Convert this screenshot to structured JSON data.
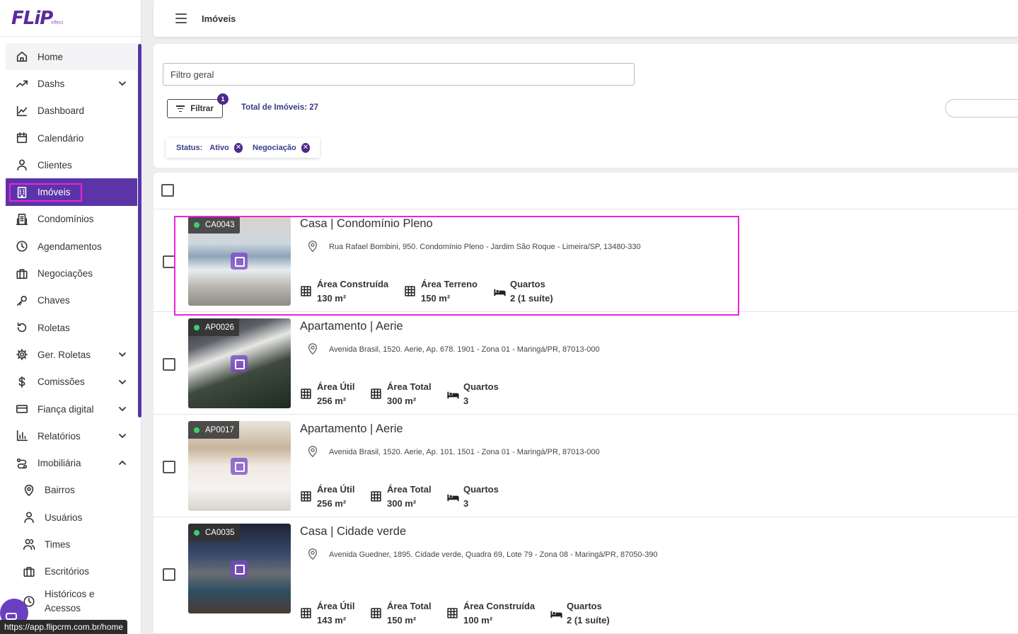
{
  "logo": {
    "text": "FLiP",
    "sub": "effect"
  },
  "sidebar": {
    "items": [
      {
        "label": "Home",
        "icon": "home-icon"
      },
      {
        "label": "Dashs",
        "icon": "trending-up-icon",
        "chevron": "down"
      },
      {
        "label": "Dashboard",
        "icon": "line-chart-icon"
      },
      {
        "label": "Calendário",
        "icon": "calendar-icon"
      },
      {
        "label": "Clientes",
        "icon": "user-icon"
      },
      {
        "label": "Imóveis",
        "icon": "building-icon",
        "active": true
      },
      {
        "label": "Condomínios",
        "icon": "apartment-icon"
      },
      {
        "label": "Agendamentos",
        "icon": "clock-icon"
      },
      {
        "label": "Negociações",
        "icon": "briefcase-icon"
      },
      {
        "label": "Chaves",
        "icon": "key-icon"
      },
      {
        "label": "Roletas",
        "icon": "rotate-icon"
      },
      {
        "label": "Ger. Roletas",
        "icon": "gear-icon",
        "chevron": "down"
      },
      {
        "label": "Comissões",
        "icon": "dollar-icon",
        "chevron": "down"
      },
      {
        "label": "Fiança digital",
        "icon": "card-icon",
        "chevron": "down"
      },
      {
        "label": "Relatórios",
        "icon": "bar-chart-icon",
        "chevron": "down"
      },
      {
        "label": "Imobiliária",
        "icon": "route-icon",
        "chevron": "up"
      },
      {
        "label": "Bairros",
        "icon": "pin-icon",
        "sub": true
      },
      {
        "label": "Usuários",
        "icon": "user-icon",
        "sub": true
      },
      {
        "label": "Times",
        "icon": "users-icon",
        "sub": true
      },
      {
        "label": "Escritórios",
        "icon": "briefcase-icon",
        "sub": true
      },
      {
        "label": "Históricos e Acessos",
        "icon": "history-icon",
        "sub": true
      }
    ],
    "status_url": "https://app.flipcrm.com.br/home"
  },
  "header": {
    "title": "Imóveis"
  },
  "filters": {
    "placeholder": "Filtro geral",
    "filter_button": "Filtrar",
    "filter_count": "1",
    "total_label": "Total de Imóveis: 27",
    "chip": {
      "label": "Status:",
      "values": [
        "Ativo",
        "Negociação"
      ]
    }
  },
  "properties": [
    {
      "code": "CA0043",
      "title": "Casa | Condomínio Pleno",
      "address": "Rua Rafael Bombini, 950. Condomínio Pleno - Jardim São Roque - Limeira/SP, 13480-330",
      "stats": [
        {
          "label": "Área Construída",
          "value": "130 m²",
          "icon": "grid-icon"
        },
        {
          "label": "Área Terreno",
          "value": "150 m²",
          "icon": "grid-icon"
        },
        {
          "label": "Quartos",
          "value": "2 (1 suíte)",
          "icon": "bed-icon"
        }
      ]
    },
    {
      "code": "AP0026",
      "title": "Apartamento | Aerie",
      "address": "Avenida Brasil, 1520. Aerie, Ap. 678. 1901 - Zona 01 - Maringá/PR, 87013-000",
      "stats": [
        {
          "label": "Área Útil",
          "value": "256 m²",
          "icon": "grid-icon"
        },
        {
          "label": "Área Total",
          "value": "300 m²",
          "icon": "grid-icon"
        },
        {
          "label": "Quartos",
          "value": "3",
          "icon": "bed-icon"
        }
      ]
    },
    {
      "code": "AP0017",
      "title": "Apartamento | Aerie",
      "address": "Avenida Brasil, 1520. Aerie, Ap. 101. 1501 - Zona 01 - Maringá/PR, 87013-000",
      "stats": [
        {
          "label": "Área Útil",
          "value": "256 m²",
          "icon": "grid-icon"
        },
        {
          "label": "Área Total",
          "value": "300 m²",
          "icon": "grid-icon"
        },
        {
          "label": "Quartos",
          "value": "3",
          "icon": "bed-icon"
        }
      ]
    },
    {
      "code": "CA0035",
      "title": "Casa | Cidade verde",
      "address": "Avenida Guedner, 1895. Cidade verde, Quadra 69, Lote 79 - Zona 08 - Maringá/PR, 87050-390",
      "stats": [
        {
          "label": "Área Útil",
          "value": "143 m²",
          "icon": "grid-icon"
        },
        {
          "label": "Área Total",
          "value": "150 m²",
          "icon": "grid-icon"
        },
        {
          "label": "Área Construída",
          "value": "100 m²",
          "icon": "grid-icon"
        },
        {
          "label": "Quartos",
          "value": "2 (1 suíte)",
          "icon": "bed-icon"
        }
      ]
    }
  ],
  "colors": {
    "accent": "#5b34a8",
    "highlight": "#ee22dd",
    "status_dot": "#3ad06b",
    "chip_text": "#3b3b8a"
  }
}
